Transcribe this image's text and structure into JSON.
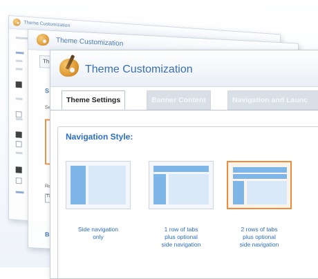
{
  "windows": {
    "back": {
      "title": "Theme Customization"
    },
    "middle": {
      "title": "Theme Customization",
      "tab": "Th",
      "label_section": "S",
      "label_side": "Se",
      "label_row": "Re",
      "field_value": "Ti",
      "bottom_label": "B"
    },
    "front": {
      "title": "Theme Customization",
      "tabs": [
        {
          "label": "Theme Settings",
          "active": true
        },
        {
          "label": "Banner Content",
          "active": false
        },
        {
          "label": "Navigation and Launc",
          "active": false
        }
      ],
      "section_title": "Navigation Style:",
      "options": [
        {
          "label_lines": [
            "Side navigation",
            "only"
          ],
          "selected": false
        },
        {
          "label_lines": [
            "1 row of tabs",
            "plus optional",
            "side navigation"
          ],
          "selected": false
        },
        {
          "label_lines": [
            "2 rows of tabs",
            "plus optional",
            "side navigation"
          ],
          "selected": true
        }
      ]
    }
  },
  "colors": {
    "accent_blue": "#2b6cc4",
    "selected_orange": "#ee8b3b",
    "block_blue": "#7fb6e8"
  },
  "icons": [
    "palette-icon",
    "paintbrush-icon"
  ]
}
